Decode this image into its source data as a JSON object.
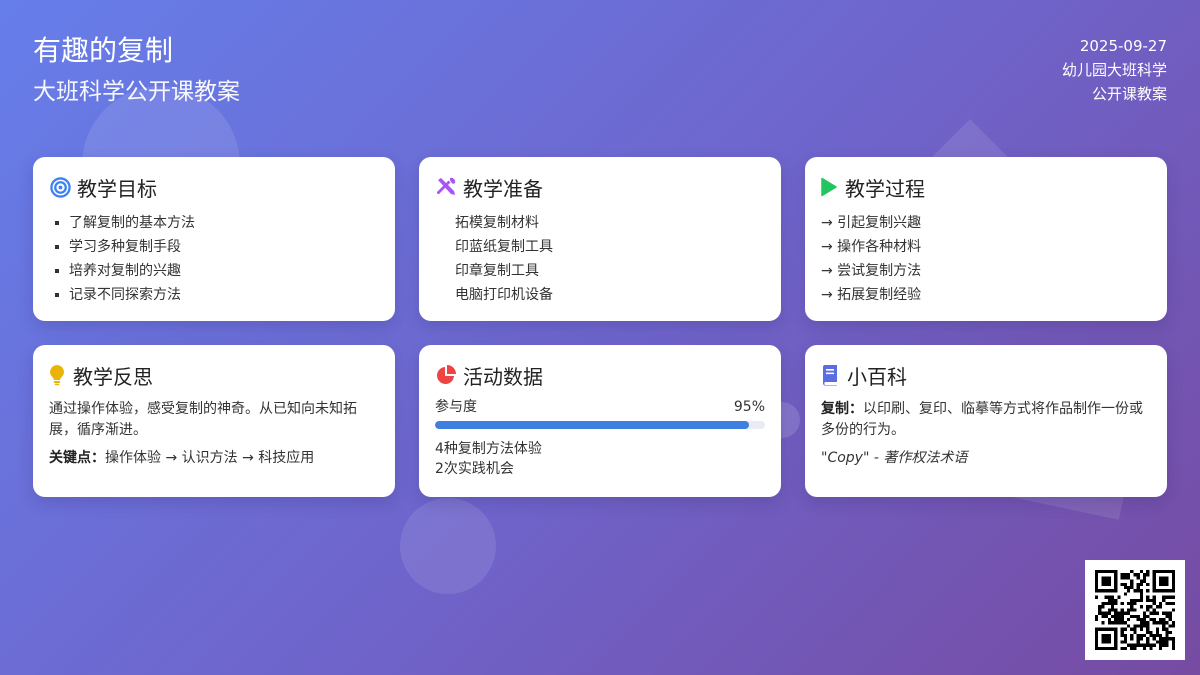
{
  "header": {
    "title": "有趣的复制",
    "subtitle": "大班科学公开课教案",
    "date": "2025-09-27",
    "meta_line1": "幼儿园大班科学",
    "meta_line2": "公开课教案"
  },
  "colors": {
    "bg_start": "#667eea",
    "bg_end": "#764ba2",
    "target_icon": "#3b82f6",
    "tools_icon": "#a855f7",
    "play_icon": "#22c55e",
    "bulb_icon": "#eab308",
    "pie_icon": "#ef4444",
    "book_icon": "#5b6ee1",
    "progress": "#3f7fe0"
  },
  "cards": {
    "goals": {
      "icon": "target-icon",
      "title": "教学目标",
      "items": [
        "了解复制的基本方法",
        "学习多种复制手段",
        "培养对复制的兴趣",
        "记录不同探索方法"
      ]
    },
    "prep": {
      "icon": "tools-icon",
      "title": "教学准备",
      "items": [
        "拓模复制材料",
        "印蓝纸复制工具",
        "印章复制工具",
        "电脑打印机设备"
      ]
    },
    "process": {
      "icon": "play-icon",
      "title": "教学过程",
      "items": [
        "→ 引起复制兴趣",
        "→ 操作各种材料",
        "→ 尝试复制方法",
        "→ 拓展复制经验"
      ]
    },
    "reflection": {
      "icon": "lightbulb-icon",
      "title": "教学反思",
      "text": "通过操作体验，感受复制的神奇。从已知向未知拓展，循序渐进。",
      "key_label": "关键点：",
      "key_text": "操作体验 → 认识方法 → 科技应用"
    },
    "stats": {
      "icon": "pie-chart-icon",
      "title": "活动数据",
      "participation_label": "参与度",
      "participation_value": "95%",
      "participation_fraction": 0.95,
      "line1": "4种复制方法体验",
      "line2": "2次实践机会"
    },
    "wiki": {
      "icon": "book-icon",
      "title": "小百科",
      "term_label": "复制：",
      "definition": "以印刷、复印、临摹等方式将作品制作一份或多份的行为。",
      "quote": "\"Copy\" - 著作权法术语"
    }
  },
  "qr": {
    "icon": "qr-code-icon"
  }
}
